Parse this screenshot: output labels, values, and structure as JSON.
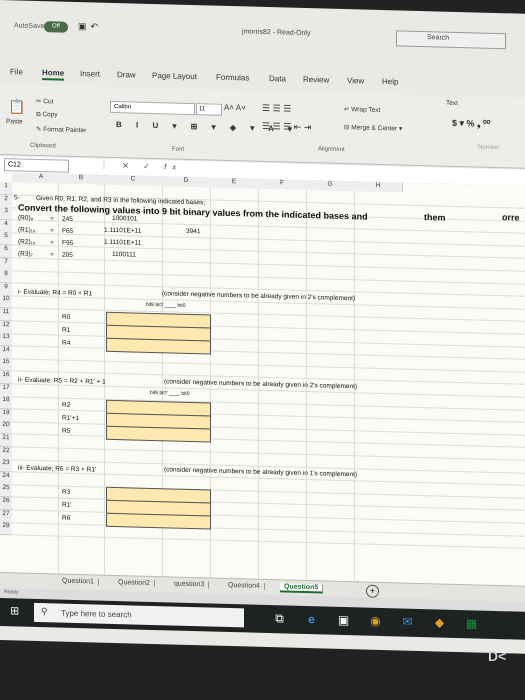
{
  "titlebar": {
    "autosave_label": "AutoSave",
    "autosave_state": "Off",
    "filename": "jmorris82 - Read-Only",
    "search_placeholder": "Search"
  },
  "menu": [
    "File",
    "Home",
    "Insert",
    "Draw",
    "Page Layout",
    "Formulas",
    "Data",
    "Review",
    "View",
    "Help"
  ],
  "ribbon": {
    "cut": "Cut",
    "copy": "Copy",
    "paste": "Paste",
    "format_painter": "Format Painter",
    "clipboard": "Clipboard",
    "font_name": "Calibri",
    "font_size": "11",
    "font_group": "Font",
    "wrap_text": "Wrap Text",
    "merge_center": "Merge & Center",
    "alignment": "Alignment",
    "number_format": "Text",
    "number_group": "Number"
  },
  "formula_bar": {
    "cell_ref": "C12",
    "fx": "fx"
  },
  "columns": [
    "A",
    "B",
    "C",
    "D",
    "E",
    "F",
    "G",
    "H"
  ],
  "rows": [
    "1",
    "2",
    "3",
    "4",
    "5",
    "6",
    "7",
    "8",
    "9",
    "10",
    "11",
    "12",
    "13",
    "14",
    "15",
    "16",
    "17",
    "18",
    "19",
    "20",
    "21",
    "22",
    "23",
    "24",
    "25",
    "26",
    "27",
    "28"
  ],
  "sheet": {
    "r1_num": "5-",
    "r1": "Given R0, R1, R2, and R3 in the following indicated bases;",
    "r2": "Convert the following values into 9 bit binary values from the indicated bases and",
    "r2_tail": "them",
    "r2_far": "orre",
    "r3_a": "(R0)₈",
    "r3_eq": "=",
    "r3_b": "245",
    "r3_c": "1000101",
    "r4_a": "(R1)₁₆",
    "r4_eq": "=",
    "r4_b": "F65",
    "r4_c": "1.11101E+11",
    "r4_d": "3941",
    "r5_a": "(R2)₁₆",
    "r5_eq": "=",
    "r5_b": "F95",
    "r5_c": "1.11101E+11",
    "r6_a": "(R3)₇",
    "r6_eq": "=",
    "r6_b": "205",
    "r6_c": "1100111",
    "r9_a": "i- Evaluate;  R4 = R0 + R1",
    "r9_note": "(consider negative numbers to be already given in 2's complement)",
    "r10_bits": "bit8  bit7 ____ bit0",
    "r11": "R0",
    "r12": "R1",
    "r13": "R4",
    "r16_a": "ii- Evaluate;  R5 = R2 + R1' + 1",
    "r16_note": "(consider negative numbers to be already given in 2's complement)",
    "r17_bits": "bit8  bit7 ____ bit0",
    "r18": "R2",
    "r19": "R1'+1",
    "r20": "R5",
    "r23_a": "iii- Evaluate;  R6 = R3 + R1'",
    "r23_note": "(consider negative numbers to be already given in 1's complement)",
    "r25": "R3",
    "r26": "R1'",
    "r27": "R6"
  },
  "tabs": [
    "Question1",
    "Question2",
    "question3",
    "Question4",
    "Question5"
  ],
  "active_tab": "Question5",
  "status": "Ready",
  "taskbar": {
    "search_placeholder": "Type here to search"
  },
  "colors": {
    "accent": "#1d6b2e",
    "answer_box": "#fde8b0"
  }
}
